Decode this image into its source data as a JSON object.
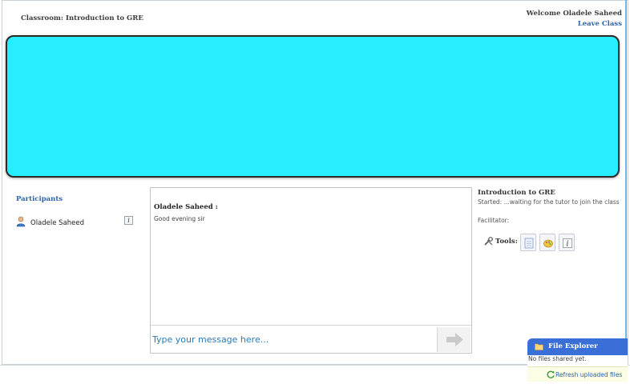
{
  "header": {
    "classroom_title": "Classroom: Introduction to GRE",
    "welcome_text": "Welcome Oladele Saheed",
    "leave_label": "Leave Class"
  },
  "stage": {
    "color": "#26eeff"
  },
  "participants": {
    "heading": "Participants",
    "items": [
      {
        "name": "Oladele Saheed",
        "icon": "user-icon",
        "info_icon": "info-icon"
      }
    ]
  },
  "chat": {
    "messages": [
      {
        "author": "Oladele Saheed :",
        "text": "Good evening sir"
      }
    ],
    "input_placeholder": "Type your message here...",
    "send_icon": "arrow-right-icon"
  },
  "class_info": {
    "title": "Introduction to GRE",
    "started": "Started: ...waiting for the tutor to join the class",
    "facilitator": "Facilitator:",
    "tools_label": "Tools:",
    "tools": [
      "notepad-icon",
      "palette-icon",
      "info-icon"
    ]
  },
  "file_explorer": {
    "title": "File Explorer",
    "status": "No files shared yet.",
    "refresh_label": "Refresh uploaded files"
  },
  "colors": {
    "accent_blue": "#2f63a8",
    "file_explorer_bg": "#3a6fd8",
    "input_text": "#2a7ab8"
  }
}
